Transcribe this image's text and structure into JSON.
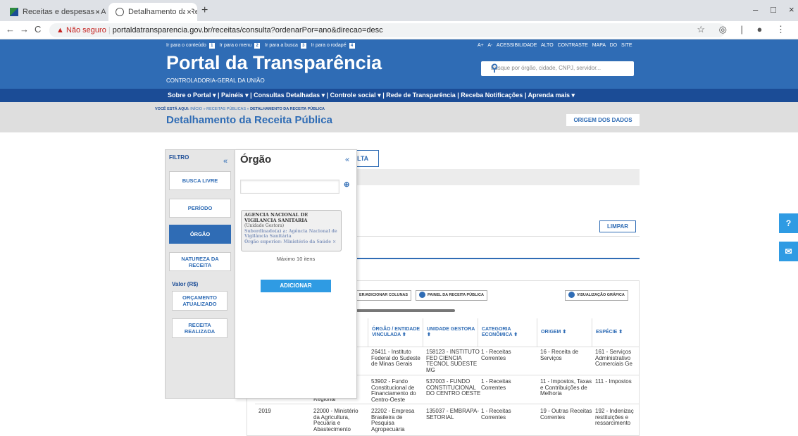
{
  "browser": {
    "tabs": [
      {
        "title": "Receitas e despesas - Anvisa",
        "close": "×"
      },
      {
        "title": "Detalhamento da Receita Pública",
        "close": "×"
      }
    ],
    "new_tab": "+",
    "window_controls": [
      "–",
      "□",
      "×"
    ],
    "nav": [
      "←",
      "→",
      "C"
    ],
    "security_warning": "▲ Não seguro",
    "url_host": "portaldatransparencia.gov.br",
    "url_path": "/receitas/consulta?ordenarPor=ano&direcao=desc",
    "addr_icons": "☆ ◎ | ● ⋮"
  },
  "header": {
    "skip_links": [
      {
        "label": "Ir para o conteúdo",
        "key": "1"
      },
      {
        "label": "Ir para o menu",
        "key": "2"
      },
      {
        "label": "Ir para a busca",
        "key": "3"
      },
      {
        "label": "Ir para o rodapé",
        "key": "4"
      }
    ],
    "accessibility": "A+  A-  ACESSIBILIDADE  ALTO CONTRASTE  MAPA DO SITE",
    "brand": "Portal da Transparência",
    "subtitle": "CONTROLADORIA-GERAL DA UNIÃO",
    "search_placeholder": "Busque por órgão, cidade, CNPJ, servidor...",
    "menu": "Sobre o Portal ▾  |  Painéis ▾  |  Consultas Detalhadas ▾  |  Controle social ▾  |  Rede de Transparência  |  Receba Notificações  |  Aprenda mais ▾"
  },
  "breadcrumb": {
    "prefix": "VOCÊ ESTÁ AQUI:",
    "path": " INÍCIO » RECEITAS PÚBLICAS » ",
    "current": "DETALHAMENTO DA RECEITA PÚBLICA"
  },
  "page_title": "Detalhamento da Receita Pública",
  "origem_button": "ORIGEM DOS DADOS",
  "filter": {
    "title": "FILTRO",
    "collapse": "«",
    "items": [
      "BUSCA LIVRE",
      "PERÍODO",
      "ÓRGÃO",
      "NATUREZA DA RECEITA"
    ],
    "valor_title": "Valor (R$)",
    "valor_items": [
      "ORÇAMENTO ATUALIZADO",
      "RECEITA REALIZADA"
    ]
  },
  "orgao_panel": {
    "title": "Órgão",
    "collapse": "«",
    "zoom": "⊕",
    "chip": {
      "name": "AGENCIA NACIONAL DE VIGILANCIA SANITARIA",
      "unit": "(Unidade Gestora)",
      "sub": "Subordinado(a) a: Agência Nacional de Vigilância Sanitária",
      "sup": "Órgão superior: Ministério da Saúde ×"
    },
    "max_text": "Máximo 10 itens",
    "add_button": "ADICIONAR"
  },
  "consulta_tab": "LTA",
  "limpar_button": "LIMPAR",
  "toolbar": {
    "columns": "ER/ADICIONAR COLUNAS",
    "painel": "PAINEL DA RECEITA PÚBLICA",
    "grafico": "VISUALIZAÇÃO GRÁFICA"
  },
  "table": {
    "headers": [
      "ÓRGÃO / ENTIDADE VINCULADA ⬍",
      "UNIDADE GESTORA ⬍",
      "CATEGORIA ECONÔMICA ⬍",
      "ORIGEM ⬍",
      "ESPÉCIE ⬍"
    ],
    "rows": [
      [
        "",
        "",
        "26411 - Instituto\nFederal do Sudeste\nde Minas Gerais",
        "158123 - INSTITUTO\nFED CIENCIA\nTECNOL SUDESTE\nMG",
        "1 - Receitas\nCorrentes",
        "16 - Receita de\nServiços",
        "161 - Serviços\nAdministrativo\nComerciais Ge"
      ],
      [
        "",
        "Regional",
        "53902 - Fundo\nConstitucional de\nFinanciamento do\nCentro-Oeste",
        "537003 - FUNDO\nCONSTITUCIONAL\nDO CENTRO OESTE",
        "1 - Receitas\nCorrentes",
        "11 - Impostos, Taxas\ne Contribuições de\nMelhoria",
        "111 - Impostos"
      ],
      [
        "2019",
        "22000 - Ministério\nda Agricultura,\nPecuária e\nAbastecimento",
        "22202 - Empresa\nBrasileira de\nPesquisa\nAgropecuária",
        "135037 - EMBRAPA-\nSETORIAL",
        "1 - Receitas\nCorrentes",
        "19 - Outras Receitas\nCorrentes",
        "192 - Indenizaç\nrestituições e\nressarcimento"
      ]
    ]
  },
  "side_buttons": [
    "?",
    "✉"
  ]
}
